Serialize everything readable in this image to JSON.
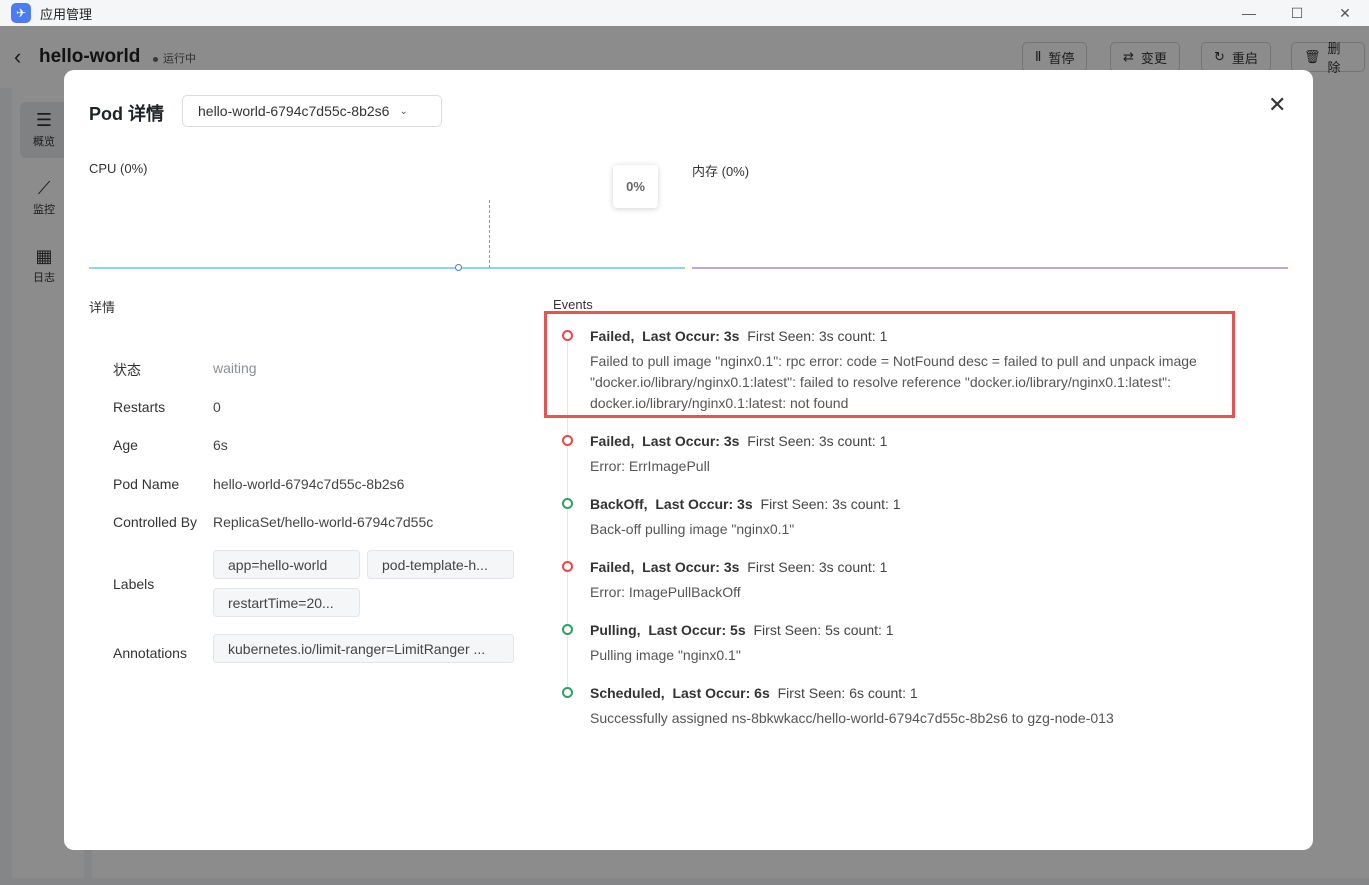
{
  "window": {
    "app_title": "应用管理",
    "minimize": "—",
    "maximize": "☐",
    "close": "✕"
  },
  "page": {
    "back": "‹",
    "title": "hello-world",
    "status": "运行中",
    "actions": [
      {
        "icon": "Ⅱ",
        "label": "暂停"
      },
      {
        "icon": "⇄",
        "label": "变更"
      },
      {
        "icon": "↻",
        "label": "重启"
      },
      {
        "icon": "🗑",
        "label": "删除"
      }
    ],
    "sidebar": [
      {
        "icon": "☰",
        "label": "概览"
      },
      {
        "icon": "⟋",
        "label": "监控"
      },
      {
        "icon": "▦",
        "label": "日志"
      }
    ]
  },
  "modal": {
    "title": "Pod 详情",
    "pod_select": "hello-world-6794c7d55c-8b2s6",
    "close": "✕",
    "cpu_label": "CPU (0%)",
    "mem_label": "内存 (0%)",
    "tooltip_value": "0%",
    "details_title": "详情",
    "events_title": "Events",
    "details": [
      {
        "label": "状态",
        "value": "waiting"
      },
      {
        "label": "Restarts",
        "value": "0"
      },
      {
        "label": "Age",
        "value": "6s"
      },
      {
        "label": "Pod Name",
        "value": "hello-world-6794c7d55c-8b2s6"
      },
      {
        "label": "Controlled By",
        "value": "ReplicaSet/hello-world-6794c7d55c"
      }
    ],
    "labels_label": "Labels",
    "labels": [
      "app=hello-world",
      "pod-template-h...",
      "restartTime=20..."
    ],
    "annotations_label": "Annotations",
    "annotations": [
      "kubernetes.io/limit-ranger=LimitRanger ..."
    ],
    "events": [
      {
        "reason": "Failed,",
        "occur": "Last Occur: 3s",
        "meta": "First Seen: 3s  count: 1",
        "message": "Failed to pull image \"nginx0.1\": rpc error: code = NotFound desc = failed to pull and unpack image \"docker.io/library/nginx0.1:latest\": failed to resolve reference \"docker.io/library/nginx0.1:latest\": docker.io/library/nginx0.1:latest: not found",
        "status_color": "#e5484d"
      },
      {
        "reason": "Failed,",
        "occur": "Last Occur: 3s",
        "meta": "First Seen: 3s  count: 1",
        "message": "Error: ErrImagePull",
        "status_color": "#e5484d"
      },
      {
        "reason": "BackOff,",
        "occur": "Last Occur: 3s",
        "meta": "First Seen: 3s  count: 1",
        "message": "Back-off pulling image \"nginx0.1\"",
        "status_color": "#2f9e68"
      },
      {
        "reason": "Failed,",
        "occur": "Last Occur: 3s",
        "meta": "First Seen: 3s  count: 1",
        "message": "Error: ImagePullBackOff",
        "status_color": "#e5484d"
      },
      {
        "reason": "Pulling,",
        "occur": "Last Occur: 5s",
        "meta": "First Seen: 5s  count: 1",
        "message": "Pulling image \"nginx0.1\"",
        "status_color": "#2f9e68"
      },
      {
        "reason": "Scheduled,",
        "occur": "Last Occur: 6s",
        "meta": "First Seen: 6s  count: 1",
        "message": "Successfully assigned ns-8bkwkacc/hello-world-6794c7d55c-8b2s6 to gzg-node-013",
        "status_color": "#2f9e68"
      }
    ]
  }
}
